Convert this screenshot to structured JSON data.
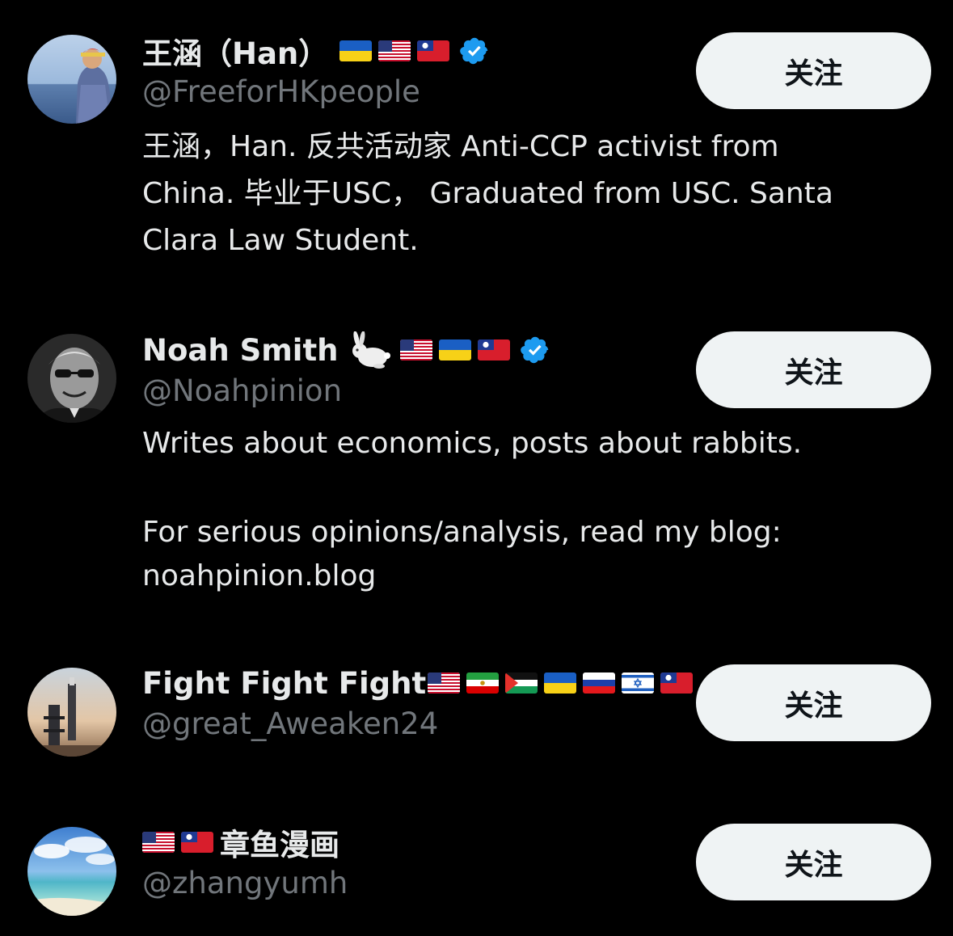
{
  "users": [
    {
      "name": "王涵（Han）",
      "handle": "@FreeforHKpeople",
      "bio_lines": [
        "王涵，Han. 反共活动家 Anti-CCP activist from",
        "China. 毕业于USC， Graduated from USC. Santa",
        "Clara Law Student."
      ],
      "flags": [
        "ukraine-flag-icon",
        "usa-flag-icon",
        "taiwan-flag-icon"
      ],
      "verified": true,
      "follow_label": "关注"
    },
    {
      "name": "Noah Smith",
      "handle": "@Noahpinion",
      "bio_lines": [
        "Writes about economics, posts about rabbits.",
        "For serious opinions/analysis, read my blog:",
        "noahpinion.blog"
      ],
      "flags": [
        "rabbit-icon",
        "usa-flag-icon",
        "ukraine-flag-icon",
        "taiwan-flag-icon"
      ],
      "verified": true,
      "follow_label": "关注"
    },
    {
      "name": "Fight Fight Fight",
      "name_suffix": "...",
      "handle": "@great_Aweaken24",
      "flags": [
        "usa-flag-icon",
        "iran-lion-sun-flag-icon",
        "palestine-flag-icon",
        "ukraine-flag-icon",
        "russia-flag-icon",
        "israel-flag-icon",
        "taiwan-flag-icon"
      ],
      "verified": false,
      "follow_label": "关注"
    },
    {
      "name": "章鱼漫画",
      "handle": "@zhangyumh",
      "flags": [
        "usa-flag-icon",
        "taiwan-flag-icon"
      ],
      "verified": false,
      "follow_label": "关注"
    }
  ],
  "colors": {
    "background": "#000000",
    "primary_text": "#e7e9ea",
    "secondary_text": "#71767b",
    "verified_badge": "#1d9bf0",
    "follow_button_bg": "#eff3f4",
    "follow_button_text": "#0f1419"
  }
}
